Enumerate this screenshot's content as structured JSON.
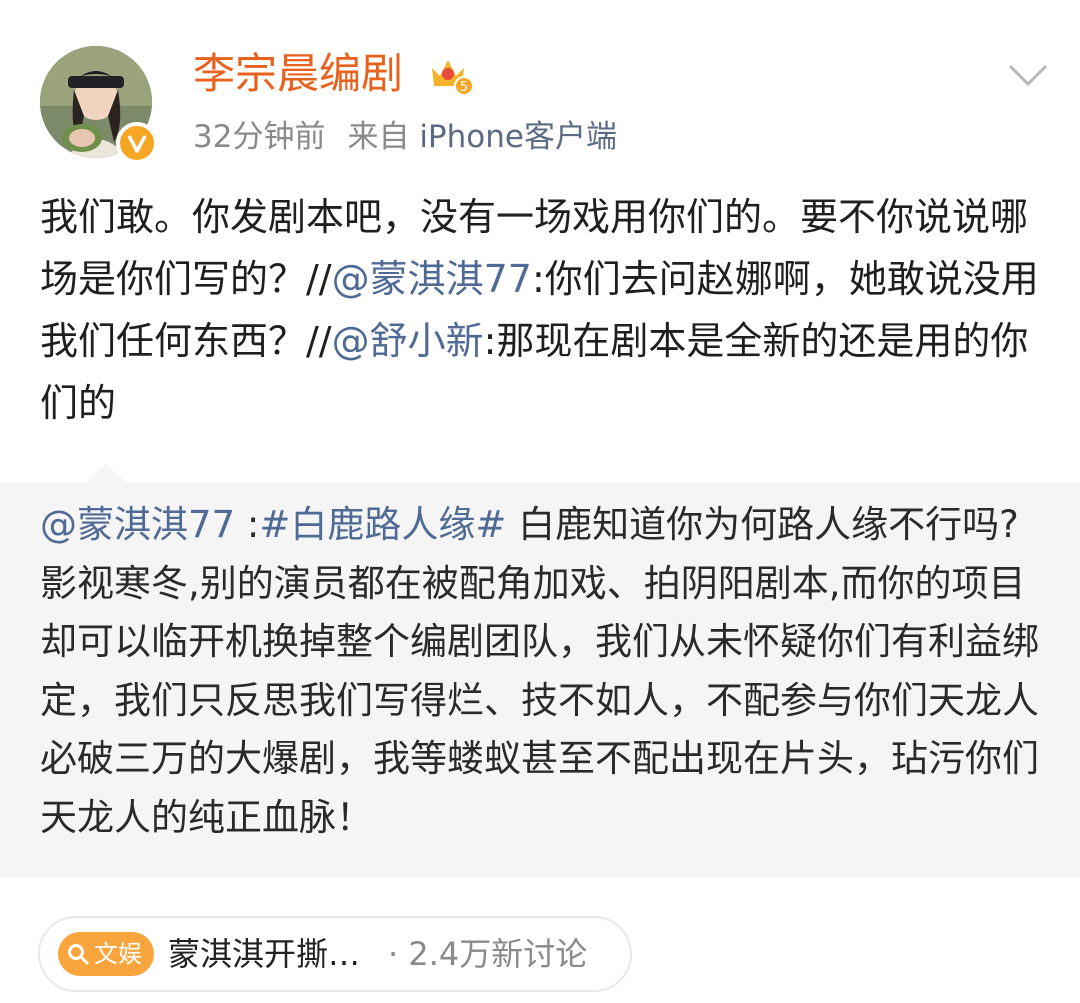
{
  "author": {
    "name": "李宗晨编剧",
    "level_badge": "5",
    "verified": true,
    "time_ago": "32分钟前",
    "source_prefix": "来自",
    "source_client": "iPhone客户端"
  },
  "post": {
    "text_1": "我们敢。你发剧本吧，没有一场戏用你们的。要不你说说哪场是你们写的？//",
    "mention_1": "@蒙淇淇77",
    "text_2": ":你们去问赵娜啊，她敢说没用我们任何东西？//",
    "mention_2": "@舒小新",
    "text_3": ":那现在剧本是全新的还是用的你们的"
  },
  "quoted": {
    "mention": "@蒙淇淇77",
    "sep": " :",
    "topic": "#白鹿路人缘#",
    "body": " 白鹿知道你为何路人缘不行吗?影视寒冬,别的演员都在被配角加戏、拍阴阳剧本,而你的项目却可以临开机换掉整个编剧团队，我们从未怀疑你们有利益绑定，我们只反思我们写得烂、技不如人，不配参与你们天龙人必破三万的大爆剧，我等蝼蚁甚至不配出现在片头，玷污你们天龙人的纯正血脉！"
  },
  "trend": {
    "badge": "文娱",
    "title": "蒙淇淇开撕…",
    "count": "· 2.4万新讨论"
  },
  "colors": {
    "name": "#e8611d",
    "link": "#4f6a95",
    "badge": "#f7a53c",
    "verified": "#f5a623"
  },
  "icons": [
    "avatar-photo",
    "verified-icon",
    "crown-level-icon",
    "chevron-down-icon",
    "search-icon"
  ]
}
